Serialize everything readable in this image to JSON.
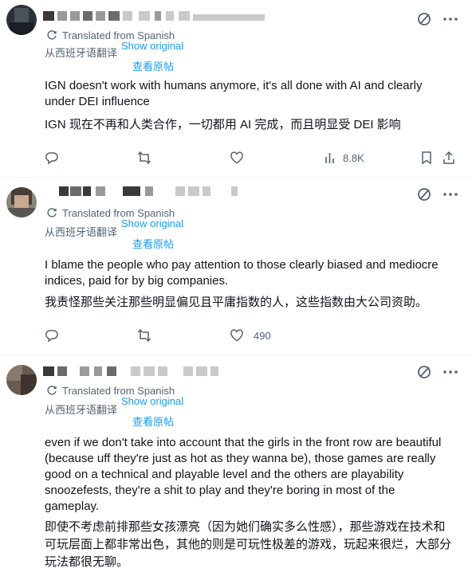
{
  "tweets": [
    {
      "translated_label": "Translated from Spanish",
      "translated_label_zh": "从西班牙语翻译",
      "show_original": "Show original",
      "show_original_zh": "查看原帖",
      "text_en": [
        "IGN doesn't work with humans anymore, it's all done with AI and clearly",
        "under DEI influence"
      ],
      "text_zh": [
        "IGN 现在不再和人类合作，一切都用 AI 完成，而且明显受 DEI 影响"
      ],
      "views": "8.8K",
      "actions": [
        "reply-icon",
        "retweet-icon",
        "like-icon",
        "views-icon",
        "bookmark-icon",
        "share-icon"
      ]
    },
    {
      "translated_label": "Translated from Spanish",
      "translated_label_zh": "从西班牙语翻译",
      "show_original": "Show original",
      "show_original_zh": "查看原帖",
      "text_en": [
        "I blame the people who pay attention to those clearly biased and mediocre",
        "indices, paid for by big companies."
      ],
      "text_zh": [
        "我责怪那些关注那些明显偏见且平庸指数的人，这些指数由大公司资助。"
      ],
      "likes": "490",
      "actions": [
        "reply-icon",
        "retweet-icon",
        "like-icon"
      ]
    },
    {
      "translated_label": "Translated from Spanish",
      "translated_label_zh": "从西班牙语翻译",
      "show_original": "Show original",
      "show_original_zh": "查看原帖",
      "text_en": [
        "even if we don't take into account that the girls in the front row are beautiful",
        "(because uff they're just as hot as they wanna be), those games are really",
        "good on a technical and playable level and the others are playability",
        "snoozefests, they're a shit to play and they're boring in most of the",
        "gameplay."
      ],
      "text_zh": [
        "即使不考虑前排那些女孩漂亮（因为她们确实多么性感），那些游戏在技术和",
        "可玩层面上都非常出色，其他的则是可玩性极差的游戏，玩起来很烂，大部分",
        "玩法都很无聊。"
      ]
    }
  ],
  "colors": {
    "text": "#0f1419",
    "muted": "#536471",
    "link": "#1d9bf0",
    "divider": "#eff3f4"
  }
}
